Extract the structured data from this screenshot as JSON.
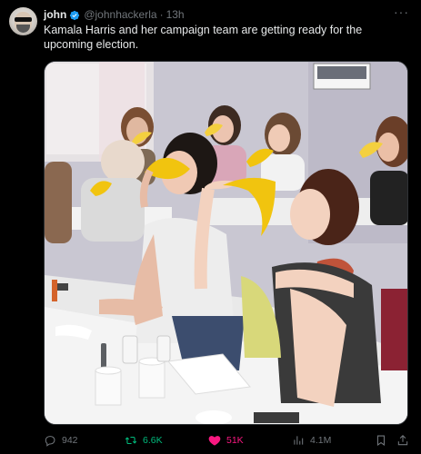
{
  "author": {
    "display_name": "john",
    "handle": "@johnhackerla",
    "separator": "·",
    "time": "13h"
  },
  "tweet": {
    "text": "Kamala Harris and her campaign team are getting ready for the upcoming election."
  },
  "more_label": "···",
  "stats": {
    "replies": "942",
    "reposts": "6.6K",
    "likes": "51K",
    "views": "4.1M"
  },
  "colors": {
    "background": "#000000",
    "text": "#e7e9ea",
    "muted": "#71767b",
    "verified": "#1d9bf0",
    "repost_active": "#00ba7c",
    "like_active": "#f91880"
  },
  "icons": {
    "more": "more-dots-icon",
    "verified": "verified-badge-icon",
    "reply": "reply-icon",
    "repost": "repost-icon",
    "like": "heart-icon",
    "views": "views-chart-icon",
    "bookmark": "bookmark-icon",
    "share": "share-icon"
  }
}
